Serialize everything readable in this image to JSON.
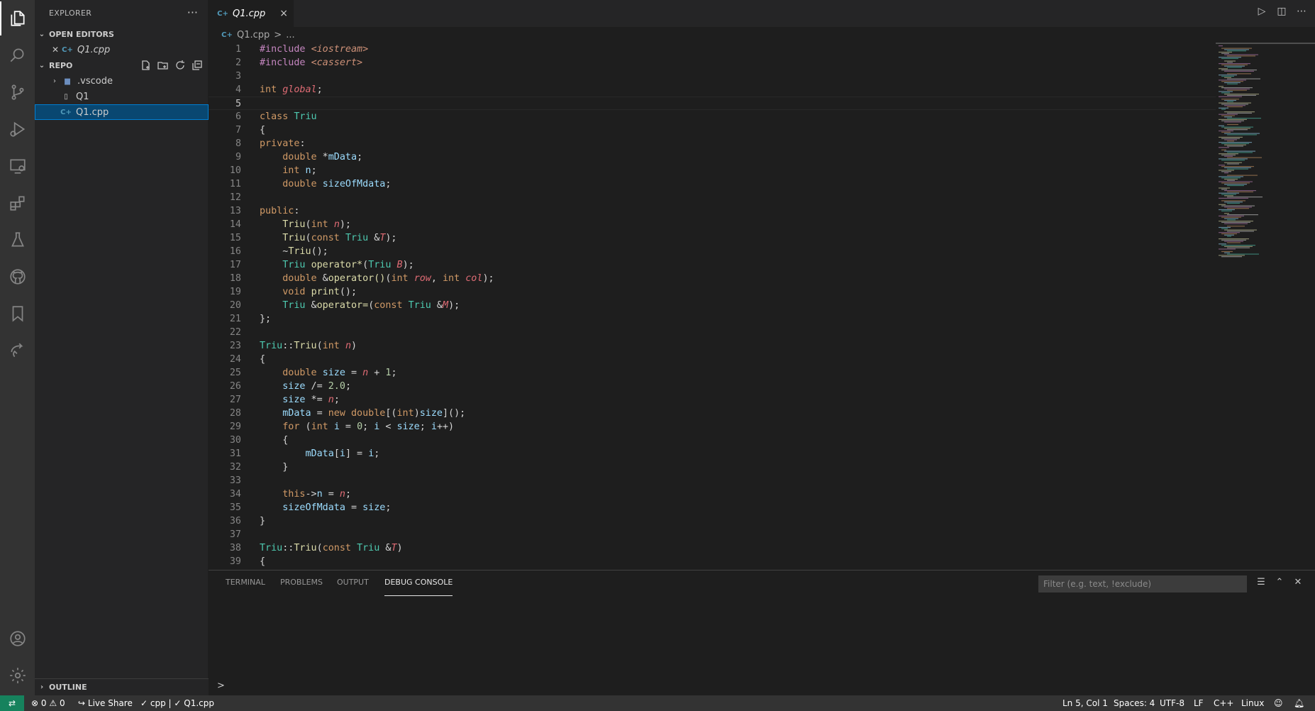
{
  "sidebar": {
    "title": "EXPLORER",
    "more": "···",
    "open_editors_label": "OPEN EDITORS",
    "open_editor_file": "Q1.cpp",
    "repo_label": "REPO",
    "tree": [
      {
        "label": ".vscode",
        "kind": "folder"
      },
      {
        "label": "Q1",
        "kind": "file"
      },
      {
        "label": "Q1.cpp",
        "kind": "cpp",
        "selected": true
      }
    ],
    "outline_label": "OUTLINE"
  },
  "tab": {
    "label": "Q1.cpp",
    "close": "×"
  },
  "breadcrumb": {
    "file": "Q1.cpp",
    "sep": ">",
    "rest": "..."
  },
  "editor": {
    "current_line": 5,
    "lines": [
      {
        "n": "1",
        "html": "<span class=\"inc\">#include</span> <span class=\"str\" style=\"font-style:italic\">&lt;iostream&gt;</span>"
      },
      {
        "n": "2",
        "html": "<span class=\"inc\">#include</span> <span class=\"str\" style=\"font-style:italic\">&lt;cassert&gt;</span>"
      },
      {
        "n": "3",
        "html": ""
      },
      {
        "n": "4",
        "html": "<span class=\"kw2\">int</span> <span class=\"it\">global</span>;"
      },
      {
        "n": "5",
        "html": ""
      },
      {
        "n": "6",
        "html": "<span class=\"kw2\">class</span> <span class=\"typ\">Triu</span>"
      },
      {
        "n": "7",
        "html": "{"
      },
      {
        "n": "8",
        "html": "<span class=\"kw2\">private</span>:"
      },
      {
        "n": "9",
        "html": "    <span class=\"kw2\">double</span> *<span class=\"var\">mData</span>;"
      },
      {
        "n": "10",
        "html": "    <span class=\"kw2\">int</span> <span class=\"var\">n</span>;"
      },
      {
        "n": "11",
        "html": "    <span class=\"kw2\">double</span> <span class=\"var\">sizeOfMdata</span>;"
      },
      {
        "n": "12",
        "html": ""
      },
      {
        "n": "13",
        "html": "<span class=\"kw2\">public</span>:"
      },
      {
        "n": "14",
        "html": "    <span class=\"fn\">Triu</span>(<span class=\"kw2\">int</span> <span class=\"it\">n</span>);"
      },
      {
        "n": "15",
        "html": "    <span class=\"fn\">Triu</span>(<span class=\"kw2\">const</span> <span class=\"typ\">Triu</span> &amp;<span class=\"it\">T</span>);"
      },
      {
        "n": "16",
        "html": "    ~<span class=\"fn\">Triu</span>();"
      },
      {
        "n": "17",
        "html": "    <span class=\"typ\">Triu</span> <span class=\"fn\">operator*</span>(<span class=\"typ\">Triu</span> <span class=\"it\">B</span>);"
      },
      {
        "n": "18",
        "html": "    <span class=\"kw2\">double</span> &amp;<span class=\"fn\">operator()</span>(<span class=\"kw2\">int</span> <span class=\"it\">row</span>, <span class=\"kw2\">int</span> <span class=\"it\">col</span>);"
      },
      {
        "n": "19",
        "html": "    <span class=\"kw2\">void</span> <span class=\"fn\">print</span>();"
      },
      {
        "n": "20",
        "html": "    <span class=\"typ\">Triu</span> &amp;<span class=\"fn\">operator=</span>(<span class=\"kw2\">const</span> <span class=\"typ\">Triu</span> &amp;<span class=\"it\">M</span>);"
      },
      {
        "n": "21",
        "html": "};"
      },
      {
        "n": "22",
        "html": ""
      },
      {
        "n": "23",
        "html": "<span class=\"typ\">Triu</span>::<span class=\"fn\">Triu</span>(<span class=\"kw2\">int</span> <span class=\"it\">n</span>)"
      },
      {
        "n": "24",
        "html": "{"
      },
      {
        "n": "25",
        "html": "    <span class=\"kw2\">double</span> <span class=\"var\">size</span> = <span class=\"it\">n</span> + <span class=\"num\">1</span>;"
      },
      {
        "n": "26",
        "html": "    <span class=\"var\">size</span> /= <span class=\"num\">2.0</span>;"
      },
      {
        "n": "27",
        "html": "    <span class=\"var\">size</span> *= <span class=\"it\">n</span>;"
      },
      {
        "n": "28",
        "html": "    <span class=\"var\">mData</span> = <span class=\"kw2\">new</span> <span class=\"kw2\">double</span>[(<span class=\"kw2\">int</span>)<span class=\"var\">size</span>]();"
      },
      {
        "n": "29",
        "html": "    <span class=\"kw2\">for</span> (<span class=\"kw2\">int</span> <span class=\"var\">i</span> = <span class=\"num\">0</span>; <span class=\"var\">i</span> &lt; <span class=\"var\">size</span>; <span class=\"var\">i</span>++)"
      },
      {
        "n": "30",
        "html": "    {"
      },
      {
        "n": "31",
        "html": "        <span class=\"var\">mData</span>[<span class=\"var\">i</span>] = <span class=\"var\">i</span>;"
      },
      {
        "n": "32",
        "html": "    }"
      },
      {
        "n": "33",
        "html": ""
      },
      {
        "n": "34",
        "html": "    <span class=\"kw2\">this</span>-&gt;<span class=\"var\">n</span> = <span class=\"it\">n</span>;"
      },
      {
        "n": "35",
        "html": "    <span class=\"var\">sizeOfMdata</span> = <span class=\"var\">size</span>;"
      },
      {
        "n": "36",
        "html": "}"
      },
      {
        "n": "37",
        "html": ""
      },
      {
        "n": "38",
        "html": "<span class=\"typ\">Triu</span>::<span class=\"fn\">Triu</span>(<span class=\"kw2\">const</span> <span class=\"typ\">Triu</span> &amp;<span class=\"it\">T</span>)"
      },
      {
        "n": "39",
        "html": "{"
      }
    ]
  },
  "panel": {
    "tabs": [
      {
        "label": "TERMINAL"
      },
      {
        "label": "PROBLEMS"
      },
      {
        "label": "OUTPUT"
      },
      {
        "label": "DEBUG CONSOLE",
        "active": true
      }
    ],
    "filter_placeholder": "Filter (e.g. text, !exclude)",
    "prompt": ">"
  },
  "statusbar": {
    "errors": "0",
    "warnings": "0",
    "live_share": "Live Share",
    "context": "✓ cpp | ✓ Q1.cpp",
    "position": "Ln 5, Col 1",
    "spaces": "Spaces: 4",
    "encoding": "UTF-8",
    "eol": "LF",
    "language": "C++",
    "platform": "Linux"
  },
  "colors": {
    "activity_bar": "#333333",
    "sidebar": "#252526",
    "editor": "#1e1e1e",
    "selection": "#094771",
    "remote": "#16825d"
  }
}
